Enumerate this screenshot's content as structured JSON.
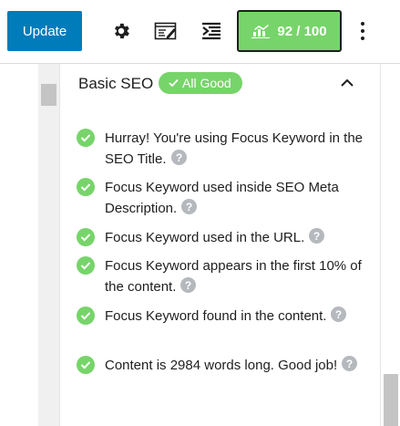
{
  "toolbar": {
    "update_label": "Update",
    "settings_icon": "gear-icon",
    "preview_icon": "edit-preview-icon",
    "schema_icon": "rank-math-icon",
    "score_label": "92 / 100",
    "more_icon": "vertical-ellipsis-icon"
  },
  "section": {
    "title": "Basic SEO",
    "badge_icon": "checkmark",
    "badge_label": "All Good",
    "collapse_icon": "chevron-up-icon"
  },
  "checks": [
    {
      "text": "Hurray! You're using Focus Keyword in the SEO Title.",
      "status": "pass"
    },
    {
      "text": "Focus Keyword used inside SEO Meta Description.",
      "status": "pass"
    },
    {
      "text": "Focus Keyword used in the URL.",
      "status": "pass"
    },
    {
      "text": "Focus Keyword appears in the first 10% of the content.",
      "status": "pass"
    },
    {
      "text": "Focus Keyword found in the content.",
      "status": "pass"
    },
    {
      "text": "Content is 2984 words long. Good job!",
      "status": "pass"
    }
  ],
  "colors": {
    "primary": "#007cba",
    "success": "#77d46a",
    "help": "#b5b9be"
  }
}
